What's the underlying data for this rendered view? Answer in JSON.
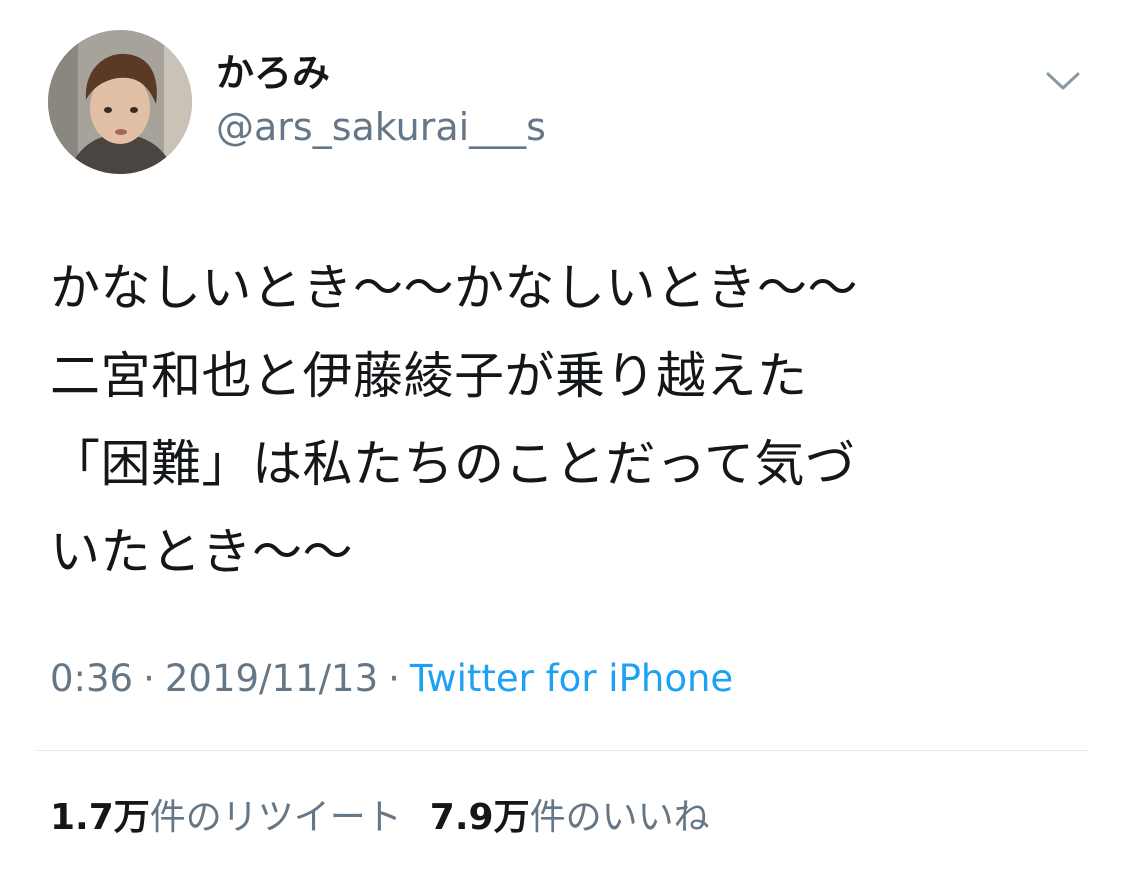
{
  "user": {
    "display_name": "かろみ",
    "handle": "@ars_sakurai___s",
    "avatar_icon": "user-avatar"
  },
  "menu": {
    "icon": "chevron-down-icon"
  },
  "tweet": {
    "text": "かなしいとき〜〜かなしいとき〜〜\n二宮和也と伊藤綾子が乗り越えた\n「困難」は私たちのことだって気づ\nいたとき〜〜",
    "time": "0:36",
    "date": "2019/11/13",
    "separator": "·",
    "source": "Twitter for iPhone"
  },
  "stats": {
    "retweets_count": "1.7万",
    "retweets_label": "件のリツイート",
    "likes_count": "7.9万",
    "likes_label": "件のいいね"
  },
  "colors": {
    "text": "#14171a",
    "secondary": "#657786",
    "link": "#1da1f2",
    "divider": "#e1e8ed"
  }
}
